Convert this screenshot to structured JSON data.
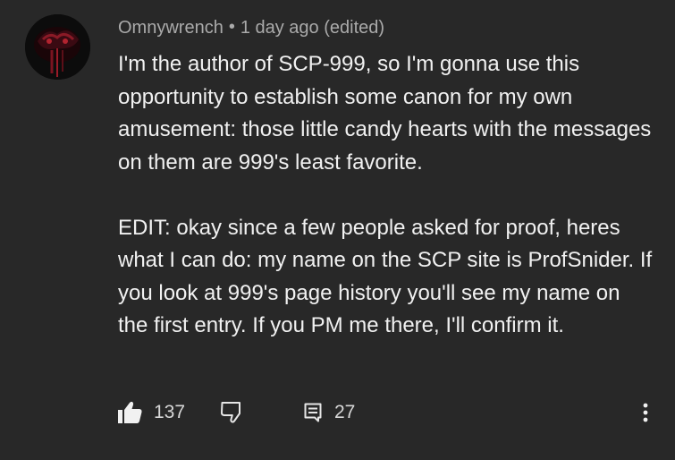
{
  "comment": {
    "author": "Omnywrench",
    "separator": "•",
    "timestamp": "1 day ago (edited)",
    "paragraphs": [
      "I'm the author of SCP-999, so I'm gonna use this opportunity to establish some canon for my own amusement: those little candy hearts with the messages on them are 999's least favorite.",
      "EDIT: okay since a few people asked for proof, heres what I can do: my name on the SCP site is ProfSnider. If you look at 999's page history you'll see my name on the first entry. If you PM me there, I'll confirm it."
    ],
    "like_count": "137",
    "reply_count": "27"
  },
  "icons": {
    "avatar": "avatar-image",
    "like": "thumbs-up-icon",
    "dislike": "thumbs-down-icon",
    "reply": "comment-icon",
    "more": "more-vertical-icon"
  },
  "colors": {
    "background": "#282828",
    "text": "#f1f1f1",
    "secondary_text": "#aaaaaa"
  }
}
